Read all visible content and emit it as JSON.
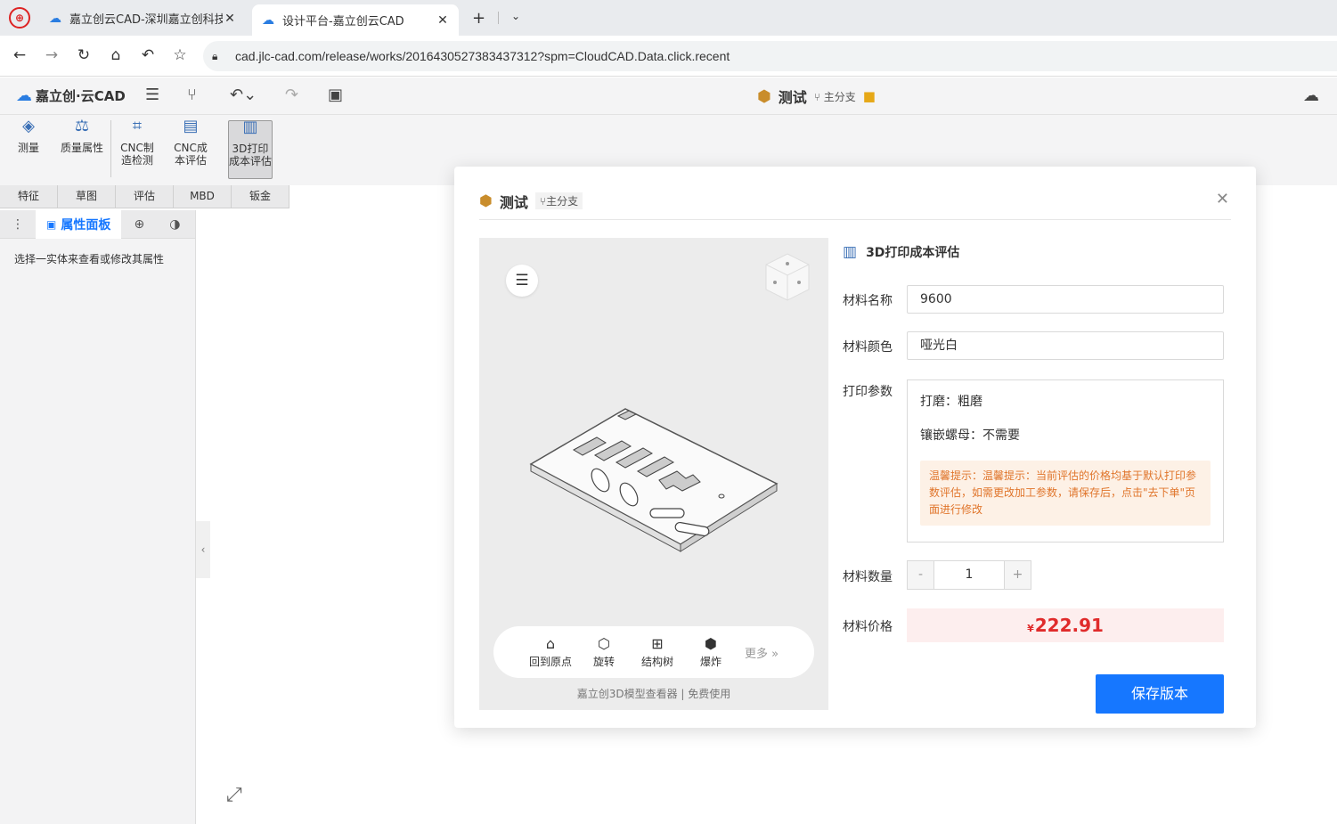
{
  "browser": {
    "tabs": [
      {
        "label": "嘉立创云CAD-深圳嘉立创科技",
        "active": false
      },
      {
        "label": "设计平台-嘉立创云CAD",
        "active": true
      }
    ],
    "url": "cad.jlc-cad.com/release/works/2016430527383437312?spm=CloudCAD.Data.click.recent"
  },
  "app": {
    "logo_text": "嘉立创·云CAD",
    "doc_name": "测试",
    "branch": "主分支"
  },
  "ribbon": {
    "buttons": [
      {
        "label": "测量"
      },
      {
        "label": "质量属性"
      },
      {
        "label": "CNC制造检测"
      },
      {
        "label": "CNC成本评估"
      },
      {
        "label": "3D打印成本评估"
      }
    ],
    "subtabs": [
      "特征",
      "草图",
      "评估",
      "MBD",
      "钣金"
    ]
  },
  "left_panel": {
    "tab_label": "属性面板",
    "hint": "选择一实体来查看或修改其属性"
  },
  "modal": {
    "title": "测试",
    "branch": "主分支",
    "viewer": {
      "tools": [
        "回到原点",
        "旋转",
        "结构树",
        "爆炸"
      ],
      "more": "更多 »",
      "credit": "嘉立创3D模型查看器 | 免费使用"
    },
    "form": {
      "title": "3D打印成本评估",
      "material_name_label": "材料名称",
      "material_name": "9600",
      "material_color_label": "材料颜色",
      "material_color": "哑光白",
      "print_params_label": "打印参数",
      "polish": "打磨：粗磨",
      "insert_nut": "镶嵌螺母：不需要",
      "tip": "温馨提示：温馨提示：当前评估的价格均基于默认打印参数评估，如需更改加工参数，请保存后，点击\"去下单\"页面进行修改",
      "quantity_label": "材料数量",
      "quantity": "1",
      "minus": "-",
      "plus": "+",
      "price_label": "材料价格",
      "currency": "¥",
      "price": "222.91",
      "save_label": "保存版本"
    }
  },
  "colors": {
    "accent": "#1677ff",
    "price": "#e02b2b",
    "tip_text": "#e0752b",
    "tip_bg": "#fdf1e6"
  }
}
